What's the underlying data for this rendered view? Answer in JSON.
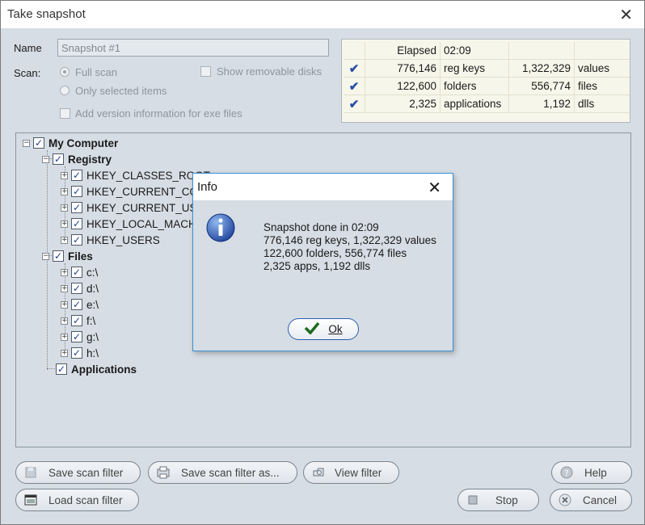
{
  "window": {
    "title": "Take snapshot",
    "close_glyph": "✕"
  },
  "form": {
    "name_label": "Name",
    "name_value": "Snapshot #1",
    "scan_label": "Scan:",
    "full_scan": "Full scan",
    "only_selected": "Only selected items",
    "show_removable": "Show removable disks",
    "add_version": "Add version information for exe files"
  },
  "stats": {
    "elapsed_label": "Elapsed",
    "elapsed_value": "02:09",
    "rows": [
      {
        "count1": "776,146",
        "label1": "reg keys",
        "count2": "1,322,329",
        "label2": "values"
      },
      {
        "count1": "122,600",
        "label1": "folders",
        "count2": "556,774",
        "label2": "files"
      },
      {
        "count1": "2,325",
        "label1": "applications",
        "count2": "1,192",
        "label2": "dlls"
      }
    ]
  },
  "tree": {
    "root": "My Computer",
    "registry": "Registry",
    "hkeys": [
      "HKEY_CLASSES_ROOT",
      "HKEY_CURRENT_CO",
      "HKEY_CURRENT_US",
      "HKEY_LOCAL_MACH",
      "HKEY_USERS"
    ],
    "files": "Files",
    "drives": [
      "c:\\",
      "d:\\",
      "e:\\",
      "f:\\",
      "g:\\",
      "h:\\"
    ],
    "applications": "Applications"
  },
  "buttons": {
    "save_filter": "Save scan filter",
    "save_filter_as": "Save scan filter as...",
    "view_filter": "View filter",
    "help": "Help",
    "load_filter": "Load scan filter",
    "stop": "Stop",
    "cancel": "Cancel"
  },
  "dialog": {
    "title": "Info",
    "close_glyph": "✕",
    "lines": [
      "Snapshot done in 02:09",
      "776,146 reg keys, 1,322,329 values",
      "122,600 folders, 556,774 files",
      "2,325 apps, 1,192 dlls"
    ],
    "ok": "Ok"
  },
  "colors": {
    "accent": "#2a5fb0",
    "window_bg": "#d6dde4",
    "stats_bg": "#f7f6ea",
    "check": "#1d3f9a"
  }
}
